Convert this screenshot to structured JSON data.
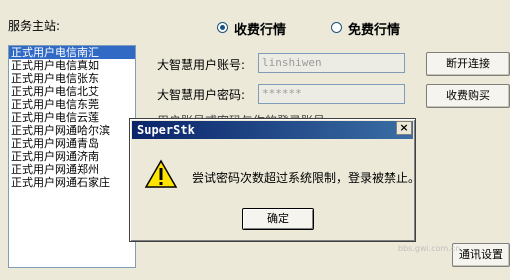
{
  "server": {
    "label": "服务主站:",
    "items": [
      "正式用户电信南汇",
      "正式用户电信真如",
      "正式用户电信张东",
      "正式用户电信北艾",
      "正式用户电信东莞",
      "正式用户电信云莲",
      "正式用户网通哈尔滨",
      "正式用户网通青岛",
      "正式用户网通济南",
      "正式用户网通郑州",
      "正式用户网通石家庄"
    ],
    "selected_index": 0
  },
  "quote_mode": {
    "options": [
      "收费行情",
      "免费行情"
    ],
    "selected_index": 0
  },
  "account": {
    "user_label": "大智慧用户账号:",
    "user_value": "linshiwen",
    "pass_label": "大智慧用户密码:",
    "pass_value": "******"
  },
  "buttons": {
    "disconnect": "断开连接",
    "buy": "收费购买",
    "comm_settings": "通讯设置"
  },
  "partial_text": "用户账号或密码与你的登录账号...",
  "dialog": {
    "title": "SuperStk",
    "close": "×",
    "message": "尝试密码次数超过系统限制，登录被禁止。",
    "ok": "确定"
  },
  "watermark": "bbs.gwi.com.cn"
}
